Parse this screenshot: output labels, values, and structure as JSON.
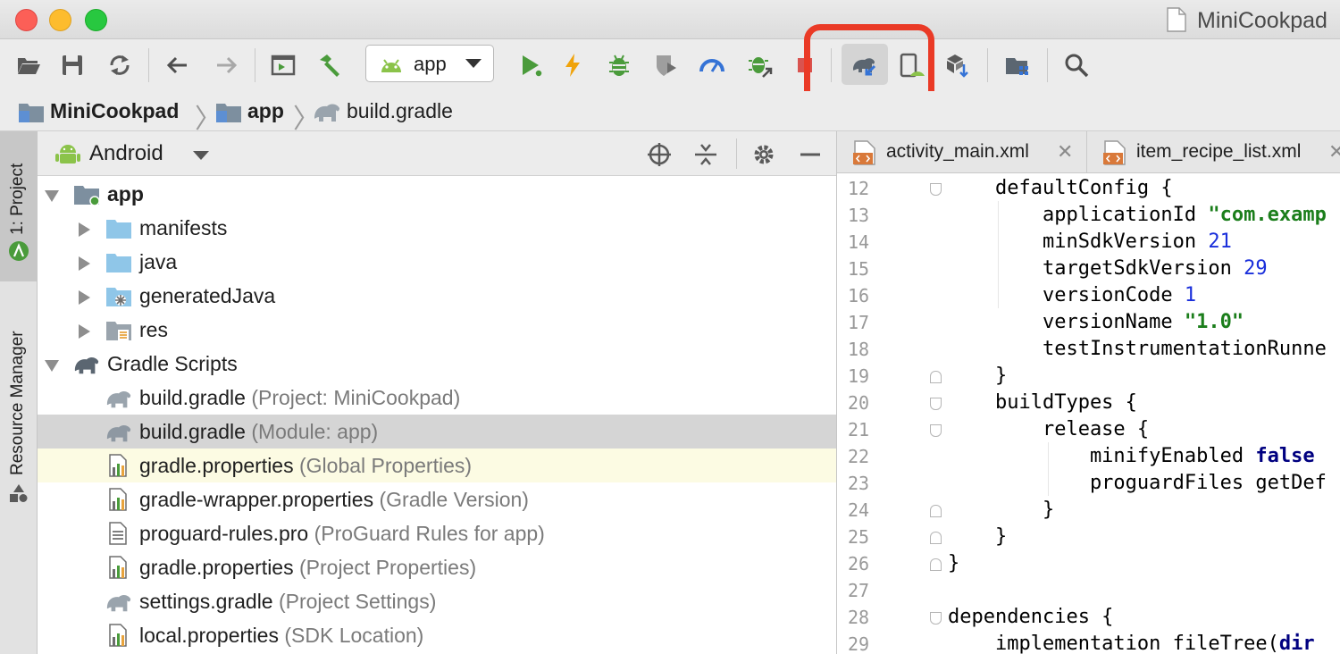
{
  "window": {
    "title": "MiniCookpad"
  },
  "toolbar": {
    "run_config": "app",
    "buttons": [
      {
        "name": "open-icon"
      },
      {
        "name": "save-all-icon"
      },
      {
        "name": "sync-icon"
      },
      {
        "name": "back-arrow-icon"
      },
      {
        "name": "forward-arrow-icon"
      },
      {
        "name": "attach-debugger-icon"
      },
      {
        "name": "build-hammer-icon"
      },
      {
        "name": "run-icon"
      },
      {
        "name": "apply-changes-icon"
      },
      {
        "name": "debug-bug-icon"
      },
      {
        "name": "coverage-shield-icon"
      },
      {
        "name": "profile-gauge-icon"
      },
      {
        "name": "attach-process-icon"
      },
      {
        "name": "stop-icon"
      },
      {
        "name": "sync-gradle-icon"
      },
      {
        "name": "avd-manager-icon"
      },
      {
        "name": "sdk-manager-icon"
      },
      {
        "name": "project-structure-icon"
      },
      {
        "name": "search-icon"
      }
    ]
  },
  "breadcrumb": {
    "items": [
      "MiniCookpad",
      "app",
      "build.gradle"
    ]
  },
  "side_strip": {
    "project_tab": "1: Project",
    "resource_tab": "Resource Manager"
  },
  "project_panel": {
    "view": "Android",
    "tree": [
      {
        "label": "app",
        "hint": "",
        "bold": true
      },
      {
        "label": "manifests",
        "hint": ""
      },
      {
        "label": "java",
        "hint": ""
      },
      {
        "label": "generatedJava",
        "hint": ""
      },
      {
        "label": "res",
        "hint": ""
      },
      {
        "label": "Gradle Scripts",
        "hint": ""
      },
      {
        "label": "build.gradle",
        "hint": "(Project: MiniCookpad)"
      },
      {
        "label": "build.gradle",
        "hint": "(Module: app)"
      },
      {
        "label": "gradle.properties",
        "hint": "(Global Properties)"
      },
      {
        "label": "gradle-wrapper.properties",
        "hint": "(Gradle Version)"
      },
      {
        "label": "proguard-rules.pro",
        "hint": "(ProGuard Rules for app)"
      },
      {
        "label": "gradle.properties",
        "hint": "(Project Properties)"
      },
      {
        "label": "settings.gradle",
        "hint": "(Project Settings)"
      },
      {
        "label": "local.properties",
        "hint": "(SDK Location)"
      }
    ]
  },
  "editor": {
    "tabs": [
      {
        "label": "activity_main.xml"
      },
      {
        "label": "item_recipe_list.xml"
      }
    ],
    "lines": [
      {
        "n": "12",
        "text": "    defaultConfig {"
      },
      {
        "n": "13",
        "pre": "        applicationId ",
        "str": "\"com.examp"
      },
      {
        "n": "14",
        "pre": "        minSdkVersion ",
        "num": "21"
      },
      {
        "n": "15",
        "pre": "        targetSdkVersion ",
        "num": "29"
      },
      {
        "n": "16",
        "pre": "        versionCode ",
        "num": "1"
      },
      {
        "n": "17",
        "pre": "        versionName ",
        "str": "\"1.0\""
      },
      {
        "n": "18",
        "text": "        testInstrumentationRunne"
      },
      {
        "n": "19",
        "text": "    }"
      },
      {
        "n": "20",
        "text": "    buildTypes {"
      },
      {
        "n": "21",
        "text": "        release {"
      },
      {
        "n": "22",
        "pre": "            minifyEnabled ",
        "kw": "false"
      },
      {
        "n": "23",
        "text": "            proguardFiles getDef"
      },
      {
        "n": "24",
        "text": "        }"
      },
      {
        "n": "25",
        "text": "    }"
      },
      {
        "n": "26",
        "text": "}"
      },
      {
        "n": "27",
        "text": ""
      },
      {
        "n": "28",
        "text": "dependencies {"
      },
      {
        "n": "29",
        "pre": "    implementation fileTree(",
        "kw": "dir"
      }
    ]
  }
}
